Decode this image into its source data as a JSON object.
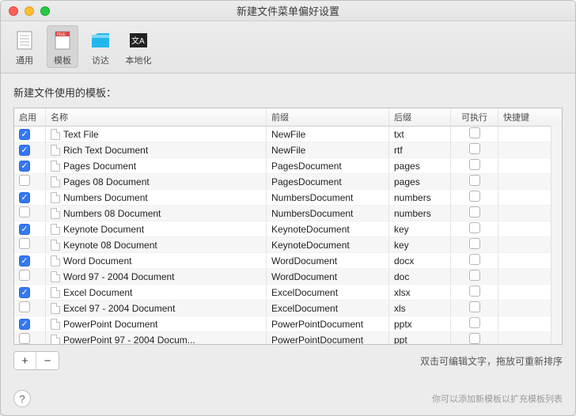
{
  "window": {
    "title": "新建文件菜单偏好设置"
  },
  "toolbar": {
    "selected": 1,
    "items": [
      {
        "label": "通用",
        "icon": "general"
      },
      {
        "label": "模板",
        "icon": "template"
      },
      {
        "label": "访达",
        "icon": "finder"
      },
      {
        "label": "本地化",
        "icon": "locale"
      }
    ]
  },
  "section_label": "新建文件使用的模板：",
  "columns": {
    "enable": "启用",
    "name": "名称",
    "prefix": "前缀",
    "suffix": "后缀",
    "executable": "可执行",
    "shortcut": "快捷键"
  },
  "rows": [
    {
      "enabled": true,
      "name": "Text File",
      "prefix": "NewFile",
      "suffix": "txt",
      "exec": false,
      "shortcut": ""
    },
    {
      "enabled": true,
      "name": "Rich Text Document",
      "prefix": "NewFile",
      "suffix": "rtf",
      "exec": false,
      "shortcut": ""
    },
    {
      "enabled": true,
      "name": "Pages Document",
      "prefix": "PagesDocument",
      "suffix": "pages",
      "exec": false,
      "shortcut": ""
    },
    {
      "enabled": false,
      "name": "Pages 08 Document",
      "prefix": "PagesDocument",
      "suffix": "pages",
      "exec": false,
      "shortcut": ""
    },
    {
      "enabled": true,
      "name": "Numbers Document",
      "prefix": "NumbersDocument",
      "suffix": "numbers",
      "exec": false,
      "shortcut": ""
    },
    {
      "enabled": false,
      "name": "Numbers 08 Document",
      "prefix": "NumbersDocument",
      "suffix": "numbers",
      "exec": false,
      "shortcut": ""
    },
    {
      "enabled": true,
      "name": "Keynote Document",
      "prefix": "KeynoteDocument",
      "suffix": "key",
      "exec": false,
      "shortcut": ""
    },
    {
      "enabled": false,
      "name": "Keynote 08 Document",
      "prefix": "KeynoteDocument",
      "suffix": "key",
      "exec": false,
      "shortcut": ""
    },
    {
      "enabled": true,
      "name": "Word Document",
      "prefix": "WordDocument",
      "suffix": "docx",
      "exec": false,
      "shortcut": ""
    },
    {
      "enabled": false,
      "name": "Word 97 - 2004 Document",
      "prefix": "WordDocument",
      "suffix": "doc",
      "exec": false,
      "shortcut": ""
    },
    {
      "enabled": true,
      "name": "Excel Document",
      "prefix": "ExcelDocument",
      "suffix": "xlsx",
      "exec": false,
      "shortcut": ""
    },
    {
      "enabled": false,
      "name": "Excel 97 - 2004 Document",
      "prefix": "ExcelDocument",
      "suffix": "xls",
      "exec": false,
      "shortcut": ""
    },
    {
      "enabled": true,
      "name": "PowerPoint Document",
      "prefix": "PowerPointDocument",
      "suffix": "pptx",
      "exec": false,
      "shortcut": ""
    },
    {
      "enabled": false,
      "name": "PowerPoint 97 - 2004 Docum...",
      "prefix": "PowerPointDocument",
      "suffix": "ppt",
      "exec": false,
      "shortcut": ""
    }
  ],
  "buttons": {
    "add": "+",
    "remove": "−"
  },
  "hint": "双击可编辑文字，拖放可重新排序",
  "footer_note": "你可以添加新模板以扩充模板列表",
  "help_label": "?"
}
